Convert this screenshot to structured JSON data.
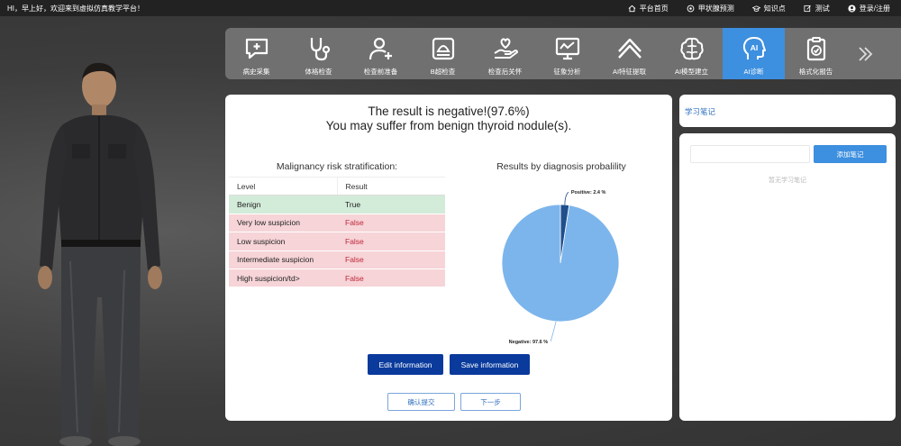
{
  "topbar": {
    "greeting": "HI，早上好，欢迎来到虚拟仿真教学平台！",
    "nav": [
      {
        "label": "平台首页",
        "icon": "home-icon"
      },
      {
        "label": "甲状腺预测",
        "icon": "target-icon"
      },
      {
        "label": "知识点",
        "icon": "graduation-cap-icon"
      },
      {
        "label": "测试",
        "icon": "edit-icon"
      },
      {
        "label": "登录/注册",
        "icon": "user-icon"
      }
    ]
  },
  "toolbar": {
    "tools": [
      {
        "label": "病史采集",
        "icon": "chat-plus-icon"
      },
      {
        "label": "体格检查",
        "icon": "stethoscope-icon"
      },
      {
        "label": "检查前准备",
        "icon": "doctor-plus-icon"
      },
      {
        "label": "B超检查",
        "icon": "ultrasound-icon"
      },
      {
        "label": "检查后关怀",
        "icon": "hand-heart-icon"
      },
      {
        "label": "征象分析",
        "icon": "monitor-chart-icon"
      },
      {
        "label": "AI特征提取",
        "icon": "layers-icon"
      },
      {
        "label": "AI模型建立",
        "icon": "brain-icon"
      },
      {
        "label": "AI诊断",
        "icon": "ai-head-icon",
        "active": true
      },
      {
        "label": "格式化报告",
        "icon": "clipboard-check-icon"
      }
    ],
    "more_icon": "double-chevron-right-icon"
  },
  "result": {
    "line1": "The result is negative!(97.6%)",
    "line2": "You may suffer from benign thyroid nodule(s)."
  },
  "risk": {
    "title": "Malignancy risk stratification:",
    "headers": {
      "level": "Level",
      "result": "Result"
    },
    "rows": [
      {
        "level": "Benign",
        "result": "True",
        "status": "benign"
      },
      {
        "level": "Very low suspicion",
        "result": "False",
        "status": "neg"
      },
      {
        "level": "Low suspicion",
        "result": "False",
        "status": "neg"
      },
      {
        "level": "Intermediate suspicion",
        "result": "False",
        "status": "neg"
      },
      {
        "level": "High suspicion/td>",
        "result": "False",
        "status": "neg"
      }
    ]
  },
  "chart_data": {
    "type": "pie",
    "title": "Results by diagnosis probalility",
    "slices": [
      {
        "name": "Positive",
        "value": 2.4,
        "label": "Positive: 2.4 %",
        "color": "#1f4e8c"
      },
      {
        "name": "Negative",
        "value": 97.6,
        "label": "Negative: 97.6 %",
        "color": "#7cb5ec"
      }
    ]
  },
  "buttons": {
    "edit": "Edit information",
    "save": "Save information",
    "confirm": "确认提交",
    "next": "下一步"
  },
  "notes": {
    "title": "学习笔记",
    "input_value": "",
    "add_label": "添加笔记",
    "empty_text": "暂无学习笔记"
  },
  "colors": {
    "accent": "#3d8fdf",
    "primary_button": "#0a3a9c",
    "benign_row": "#d3ebd9",
    "negative_row": "#f6d4d7"
  }
}
